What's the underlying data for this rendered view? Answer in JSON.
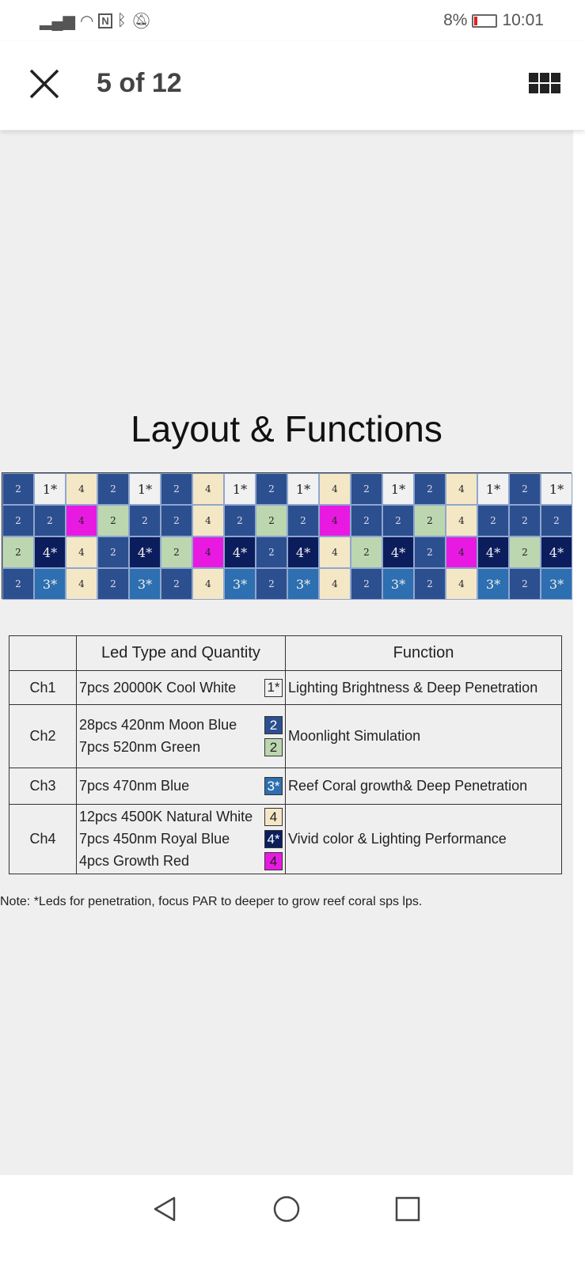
{
  "status_bar": {
    "battery": "8%",
    "time": "10:01",
    "icons": [
      "signal-icon",
      "wifi-icon",
      "nfc-icon",
      "bluetooth-icon",
      "bell-off-icon"
    ]
  },
  "header": {
    "title": "5 of 12",
    "close_icon": "close-icon",
    "grid_icon": "grid-view-icon"
  },
  "image": {
    "heading": "Layout  &  Functions",
    "led_legend": {
      "b": "2",
      "g": "2",
      "w": "1*",
      "y": "4",
      "m": "4",
      "n": "4*",
      "t": "3*"
    },
    "led_colors": {
      "b": "#2c4f8f",
      "g": "#bcd6b0",
      "w": "#f1f1f1",
      "y": "#f3e7c6",
      "m": "#e81ae2",
      "n": "#0b1d5c",
      "t": "#2d6fb0"
    },
    "led_rows": [
      [
        "b",
        "w",
        "y",
        "b",
        "w",
        "b",
        "y",
        "w",
        "b",
        "w",
        "y",
        "b",
        "w",
        "b",
        "y",
        "w",
        "b",
        "w"
      ],
      [
        "b",
        "b",
        "m",
        "g",
        "b",
        "b",
        "y",
        "b",
        "g",
        "b",
        "m",
        "b",
        "b",
        "g",
        "y",
        "b",
        "b",
        "b"
      ],
      [
        "g",
        "n",
        "y",
        "b",
        "n",
        "g",
        "m",
        "n",
        "b",
        "n",
        "y",
        "g",
        "n",
        "b",
        "m",
        "n",
        "g",
        "n"
      ],
      [
        "b",
        "t",
        "y",
        "b",
        "t",
        "b",
        "y",
        "t",
        "b",
        "t",
        "y",
        "b",
        "t",
        "b",
        "y",
        "t",
        "b",
        "t"
      ]
    ],
    "table": {
      "headers": [
        "",
        "Led Type and Quantity",
        "Function"
      ],
      "rows": [
        {
          "channel": "Ch1",
          "items": [
            {
              "text": "7pcs 20000K Cool White",
              "code": "1*",
              "color": "w"
            }
          ],
          "function": "Lighting Brightness & Deep Penetration"
        },
        {
          "channel": "Ch2",
          "items": [
            {
              "text": "28pcs 420nm Moon Blue",
              "code": "2",
              "color": "b"
            },
            {
              "text": "7pcs 520nm Green",
              "code": "2",
              "color": "g"
            }
          ],
          "function": "Moonlight Simulation"
        },
        {
          "channel": "Ch3",
          "items": [
            {
              "text": "7pcs 470nm Blue",
              "code": "3*",
              "color": "t"
            }
          ],
          "function": "Reef Coral growth& Deep Penetration"
        },
        {
          "channel": "Ch4",
          "items": [
            {
              "text": "12pcs 4500K Natural White",
              "code": "4",
              "color": "y"
            },
            {
              "text": "7pcs 450nm Royal Blue",
              "code": "4*",
              "color": "n"
            },
            {
              "text": "4pcs Growth Red",
              "code": "4",
              "color": "m"
            }
          ],
          "function": "Vivid color & Lighting Performance"
        }
      ]
    },
    "note": "Note: *Leds for penetration, focus PAR to deeper to grow reef coral sps lps."
  },
  "nav_bar": {
    "icons": [
      "back-icon",
      "home-icon",
      "recents-icon"
    ]
  }
}
